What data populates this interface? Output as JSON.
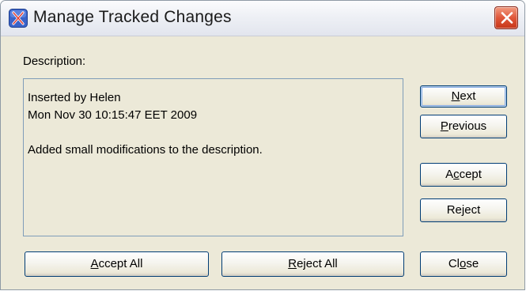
{
  "window": {
    "title": "Manage Tracked Changes",
    "app_icon": "x-app-icon",
    "close_icon": "close-icon"
  },
  "description": {
    "label": "Description:",
    "lines": [
      "Inserted by Helen",
      "Mon Nov 30 10:15:47 EET 2009",
      "",
      "Added small modifications to the description."
    ]
  },
  "buttons": {
    "next": {
      "before": "",
      "mnemonic": "N",
      "after": "ext"
    },
    "previous": {
      "before": "",
      "mnemonic": "P",
      "after": "revious"
    },
    "accept": {
      "before": "A",
      "mnemonic": "c",
      "after": "cept"
    },
    "reject": {
      "before": "Re",
      "mnemonic": "j",
      "after": "ect"
    },
    "accept_all": {
      "before": "",
      "mnemonic": "A",
      "after": "ccept All"
    },
    "reject_all": {
      "before": "",
      "mnemonic": "R",
      "after": "eject All"
    },
    "close": {
      "before": "Cl",
      "mnemonic": "o",
      "after": "se"
    }
  },
  "colors": {
    "dialog_bg": "#ece9d8",
    "button_border": "#003c74",
    "textbox_border": "#7f9db9",
    "close_button": "#e0573a"
  }
}
